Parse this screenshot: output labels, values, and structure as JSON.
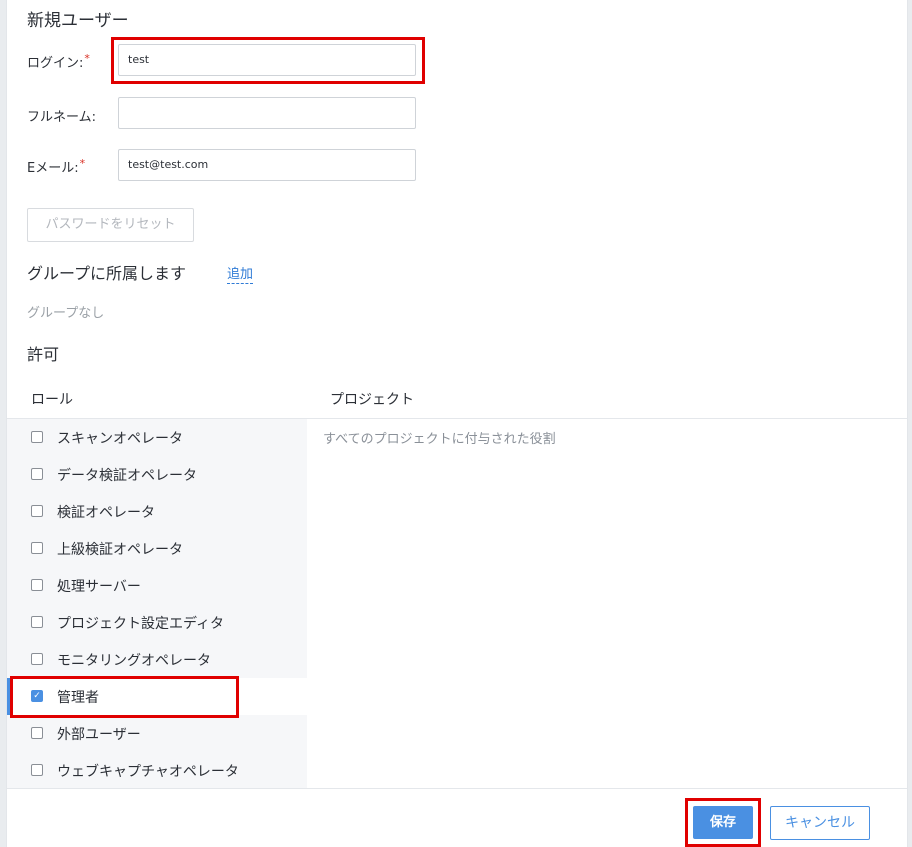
{
  "form": {
    "title": "新規ユーザー",
    "login": {
      "label": "ログイン:",
      "required_mark": "*",
      "value": "test"
    },
    "fullname": {
      "label": "フルネーム:",
      "value": ""
    },
    "email": {
      "label": "Eメール:",
      "required_mark": "*",
      "value": "test@test.com"
    },
    "reset_password_label": "パスワードをリセット"
  },
  "groups": {
    "title": "グループに所属します",
    "add_label": "追加",
    "empty_text": "グループなし"
  },
  "permissions": {
    "title": "許可",
    "col_role": "ロール",
    "col_project": "プロジェクト",
    "project_note": "すべてのプロジェクトに付与された役割",
    "roles": [
      {
        "label": "スキャンオペレータ",
        "checked": false
      },
      {
        "label": "データ検証オペレータ",
        "checked": false
      },
      {
        "label": "検証オペレータ",
        "checked": false
      },
      {
        "label": "上級検証オペレータ",
        "checked": false
      },
      {
        "label": "処理サーバー",
        "checked": false
      },
      {
        "label": "プロジェクト設定エディタ",
        "checked": false
      },
      {
        "label": "モニタリングオペレータ",
        "checked": false
      },
      {
        "label": "管理者",
        "checked": true
      },
      {
        "label": "外部ユーザー",
        "checked": false
      },
      {
        "label": "ウェブキャプチャオペレータ",
        "checked": false
      }
    ]
  },
  "footer": {
    "save_label": "保存",
    "cancel_label": "キャンセル"
  },
  "colors": {
    "accent": "#4a90e2",
    "highlight": "#e00000",
    "required": "#d93025"
  }
}
